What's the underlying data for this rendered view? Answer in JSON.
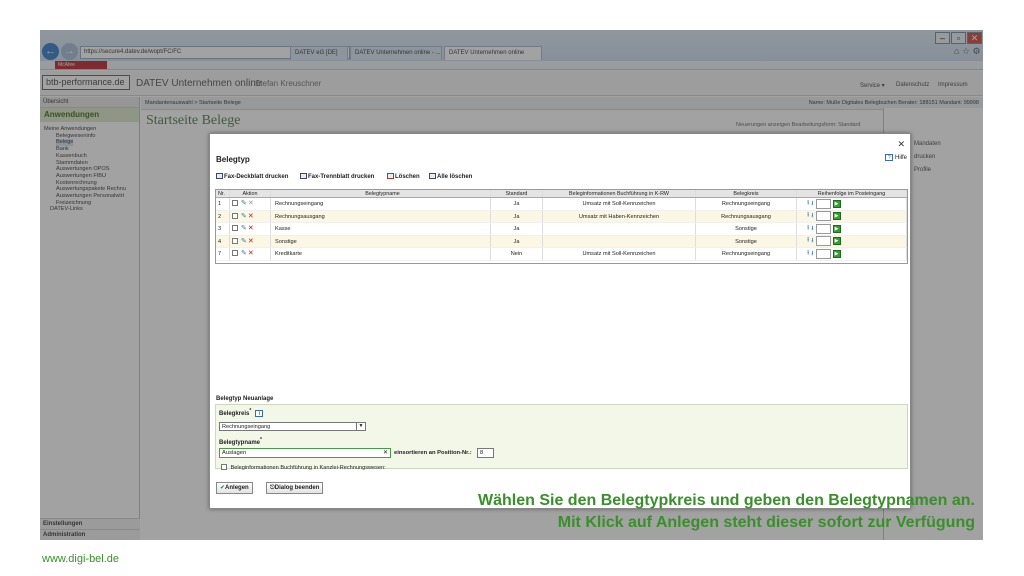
{
  "browser": {
    "url": "https://secure4.datev.de/wopt/FC/FC",
    "tabs": [
      "DATEV eG [DE]",
      "DATEV Unternehmen online - ...",
      "DATEV Unternehmen online"
    ],
    "toolbar_label": "McAfee"
  },
  "app": {
    "logo": "btb-performance.de",
    "title": "DATEV Unternehmen online",
    "user": "Stefan Kreuschner",
    "links": [
      "Service ▾",
      "Datenschutz",
      "Impressum"
    ]
  },
  "sidebar": {
    "header": "Übersicht",
    "group": "Anwendungen",
    "tree": [
      "Meine Anwendungen",
      "Belegwesen­info",
      "Belege",
      "Bank",
      "Kassenbuch",
      "Stammdaten",
      "Auswertungen OPOS",
      "Auswertungen FIBU",
      "Kostenrechnung",
      "Auswertungspakete Rechnu",
      "Auswertungen Personalwirt",
      "Freizeichnung",
      "DATEV-Links"
    ],
    "bottom": [
      "Einstellungen",
      "Administration"
    ]
  },
  "main": {
    "breadcrumb": "Mandantenauswahl   >  Startseite Belege",
    "info": "Name: Muße Digitales Belegbuchen  Berater: 188151  Mandant: 99998",
    "page_title": "Startseite Belege",
    "subinfo": "Neuerungen anzeigen  Bearbeitungsform: Standard",
    "right_panel": [
      "Mandaten",
      "drucken",
      "Profile"
    ]
  },
  "dialog": {
    "title": "Belegtyp",
    "help": "Hilfe",
    "toolbar": [
      "Fax-Deckblatt drucken",
      "Fax-Trennblatt drucken",
      "Löschen",
      "Alle löschen"
    ],
    "columns": [
      "Nr.",
      "Aktion",
      "Belegtypname",
      "Standard",
      "Beleginformationen Buchführung in K-RW",
      "Belegkreis",
      "Reihenfolge im Posteingang"
    ],
    "rows": [
      {
        "nr": "1",
        "name": "Rechnungseingang",
        "standard": "Ja",
        "info": "Umsatz mit Soll-Kennzeichen",
        "kreis": "Rechnungseingang"
      },
      {
        "nr": "2",
        "name": "Rechnungsausgang",
        "standard": "Ja",
        "info": "Umsatz mit Haben-Kennzeichen",
        "kreis": "Rechnungsausgang"
      },
      {
        "nr": "3",
        "name": "Kasse",
        "standard": "Ja",
        "info": "",
        "kreis": "Sonstige"
      },
      {
        "nr": "4",
        "name": "Sonstige",
        "standard": "Ja",
        "info": "",
        "kreis": "Sonstige"
      },
      {
        "nr": "7",
        "name": "Kreditkarte",
        "standard": "Nein",
        "info": "Umsatz mit Soll-Kennzeichen",
        "kreis": "Rechnungseingang"
      }
    ],
    "new_section": "Belegtyp Neuanlage",
    "belegkreis_label": "Belegkreis",
    "belegkreis_value": "Rechnungseingang",
    "belegtypname_label": "Belegtypname",
    "belegtypname_value": "Auslagen",
    "einsortieren_label": "einsortieren an Position-Nr.:",
    "position_value": "8",
    "checkbox_label": "Beleginformationen Buchführung in Kanzlei-Rechnungswesen:",
    "btn_anlegen": "Anlegen",
    "btn_beenden": "Dialog beenden"
  },
  "caption": "Wählen Sie den Belegtypkreis und geben den Belegtypnamen an. Mit Klick auf Anlegen steht dieser sofort zur Verfügung",
  "footer": "www.digi-bel.de"
}
